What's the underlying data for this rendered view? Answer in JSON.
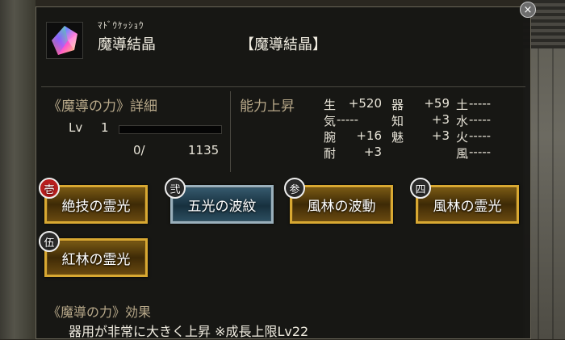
{
  "item": {
    "kana": "ﾏﾄﾞｳｹｯｼｮｳ",
    "name": "魔導結晶",
    "bracket_name": "【魔導結晶】",
    "icon": "crystal-icon"
  },
  "detail": {
    "title": "《魔導の力》詳細",
    "level_label": "Lv",
    "level_value": "1",
    "xp_current": "0/",
    "xp_total": "1135",
    "xp_progress": 0.0
  },
  "stats": {
    "title": "能力上昇",
    "col1": [
      {
        "label": "生",
        "value": "+520"
      },
      {
        "label": "気",
        "value": "-----"
      },
      {
        "label": "腕",
        "value": "+16"
      },
      {
        "label": "耐",
        "value": "+3"
      }
    ],
    "col2": [
      {
        "label": "器",
        "value": "+59"
      },
      {
        "label": "知",
        "value": "+3"
      },
      {
        "label": "魅",
        "value": "+3"
      }
    ],
    "col3": [
      {
        "label": "土",
        "value": "-----"
      },
      {
        "label": "水",
        "value": "-----"
      },
      {
        "label": "火",
        "value": "-----"
      },
      {
        "label": "風",
        "value": "-----"
      }
    ]
  },
  "skills": [
    {
      "badge": "壱",
      "label": "絶技の霊光",
      "style": "gold"
    },
    {
      "badge": "弐",
      "label": "五光の波紋",
      "style": "blue"
    },
    {
      "badge": "参",
      "label": "風林の波動",
      "style": "gold"
    },
    {
      "badge": "四",
      "label": "風林の霊光",
      "style": "gold"
    },
    {
      "badge": "伍",
      "label": "紅林の霊光",
      "style": "gold"
    }
  ],
  "effect": {
    "title": "《魔導の力》効果",
    "text": "器用が非常に大きく上昇 ※成長上限Lv22"
  },
  "close_label": "×",
  "colors": {
    "gold_border": "#d8a832",
    "blue_border": "#9ab0bc",
    "header_text": "#b8a98a",
    "badge_red": "#b81e1e"
  }
}
